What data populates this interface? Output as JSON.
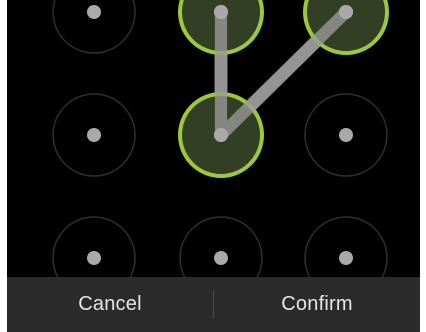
{
  "pattern_lock": {
    "grid": [
      3,
      3
    ],
    "path": [
      1,
      4,
      2
    ],
    "colors": {
      "selected_ring": "#9dc83a",
      "selected_fill": "#3c4a2a",
      "idle_ring": "#2e2e2e",
      "dot": "#a9a9a9",
      "line": "#9a9a9a"
    }
  },
  "actions": {
    "cancel_label": "Cancel",
    "confirm_label": "Confirm"
  }
}
